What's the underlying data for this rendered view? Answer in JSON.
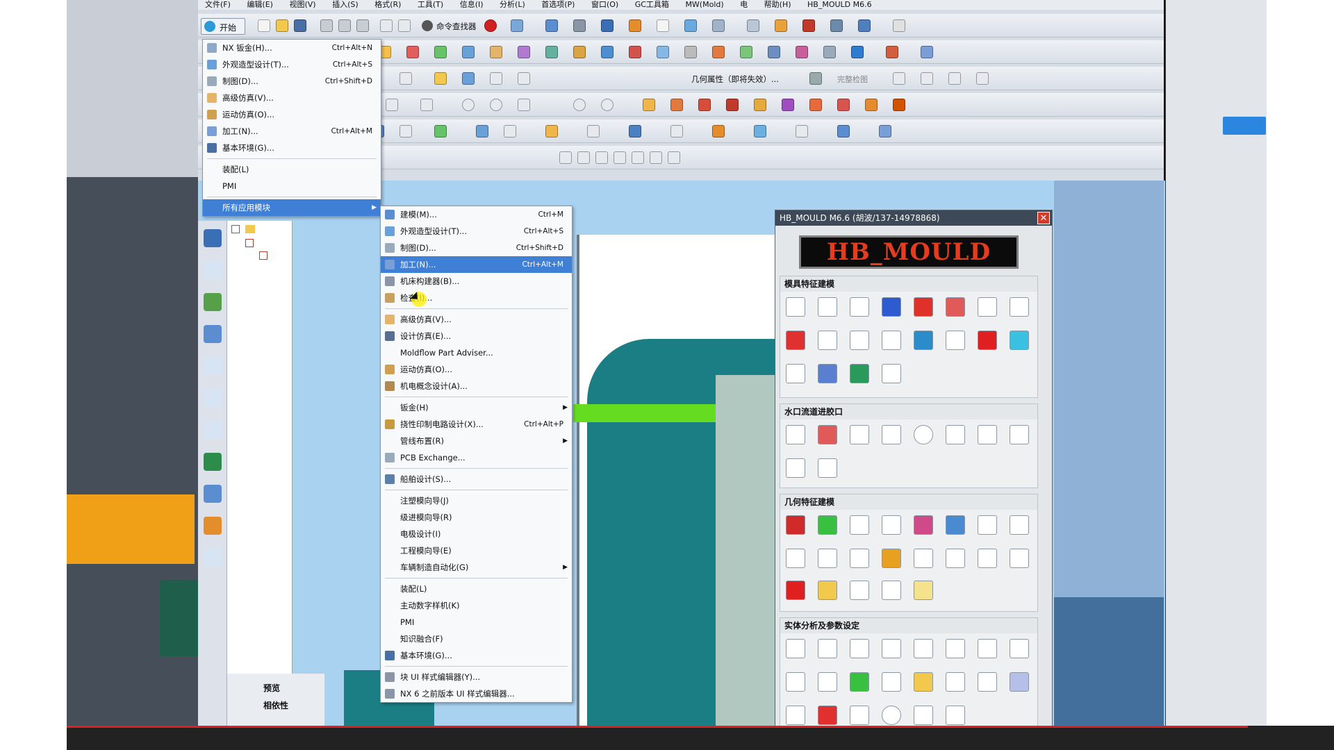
{
  "menubar": [
    "分析(L)",
    "首选项(P)",
    "窗口",
    "文件(F)",
    "编辑(E)",
    "视图(V)",
    "插入(S)",
    "格式(R)",
    "工具(T)",
    "信息(I)",
    "分析(L)",
    "首选项(P)",
    "窗口(O)",
    "GC工具箱",
    "MW(Mold)",
    "电",
    "帮助(H)",
    "HB_MOULD M6.6"
  ],
  "toolbar": {
    "start_label": "开始",
    "cmd_finder_label": "命令查找器",
    "geom_attr_label": "几何属性（即将失效）...",
    "full_check_label": "完整检图"
  },
  "start_menu": {
    "items": [
      {
        "label": "NX 钣金(H)...",
        "shortcut": "Ctrl+Alt+N"
      },
      {
        "label": "外观造型设计(T)...",
        "shortcut": "Ctrl+Alt+S"
      },
      {
        "label": "制图(D)...",
        "shortcut": "Ctrl+Shift+D"
      },
      {
        "label": "高级仿真(V)...",
        "shortcut": ""
      },
      {
        "label": "运动仿真(O)...",
        "shortcut": ""
      },
      {
        "label": "加工(N)...",
        "shortcut": "Ctrl+Alt+M"
      },
      {
        "label": "基本环境(G)...",
        "shortcut": ""
      },
      {
        "label": "装配(L)",
        "shortcut": ""
      },
      {
        "label": "PMI",
        "shortcut": ""
      },
      {
        "label": "所有应用模块",
        "shortcut": ""
      }
    ]
  },
  "all_apps_menu": {
    "items": [
      {
        "label": "建模(M)...",
        "shortcut": "Ctrl+M"
      },
      {
        "label": "外观造型设计(T)...",
        "shortcut": "Ctrl+Alt+S"
      },
      {
        "label": "制图(D)...",
        "shortcut": "Ctrl+Shift+D"
      },
      {
        "label": "加工(N)...",
        "shortcut": "Ctrl+Alt+M"
      },
      {
        "label": "机床构建器(B)...",
        "shortcut": ""
      },
      {
        "label": "检查(I)...",
        "shortcut": ""
      },
      {
        "label": "高级仿真(V)...",
        "shortcut": ""
      },
      {
        "label": "设计仿真(E)...",
        "shortcut": ""
      },
      {
        "label": "Moldflow Part Adviser...",
        "shortcut": ""
      },
      {
        "label": "运动仿真(O)...",
        "shortcut": ""
      },
      {
        "label": "机电概念设计(A)...",
        "shortcut": ""
      },
      {
        "label": "钣金(H)",
        "shortcut": ""
      },
      {
        "label": "挠性印制电路设计(X)...",
        "shortcut": "Ctrl+Alt+P"
      },
      {
        "label": "管线布置(R)",
        "shortcut": ""
      },
      {
        "label": "PCB Exchange...",
        "shortcut": ""
      },
      {
        "label": "船舶设计(S)...",
        "shortcut": ""
      },
      {
        "label": "注塑模向导(J)",
        "shortcut": ""
      },
      {
        "label": "级进模向导(R)",
        "shortcut": ""
      },
      {
        "label": "电极设计(I)",
        "shortcut": ""
      },
      {
        "label": "工程模向导(E)",
        "shortcut": ""
      },
      {
        "label": "车辆制造自动化(G)",
        "shortcut": ""
      },
      {
        "label": "装配(L)",
        "shortcut": ""
      },
      {
        "label": "主动数字样机(K)",
        "shortcut": ""
      },
      {
        "label": "PMI",
        "shortcut": ""
      },
      {
        "label": "知识融合(F)",
        "shortcut": ""
      },
      {
        "label": "基本环境(G)...",
        "shortcut": ""
      },
      {
        "label": "块 UI 样式编辑器(Y)...",
        "shortcut": ""
      },
      {
        "label": "NX 6 之前版本 UI 样式编辑器...",
        "shortcut": ""
      }
    ]
  },
  "navigator": {
    "preview_label": "预览",
    "dependency_label": "相依性"
  },
  "hb_mould": {
    "title": "HB_MOULD M6.6 (胡波/137-14978868)",
    "logo_text": "HB_MOULD",
    "sections": [
      {
        "title": "模具特征建模"
      },
      {
        "title": "水口流道进胶口"
      },
      {
        "title": "几何特征建模"
      },
      {
        "title": "实体分析及参数设定"
      }
    ]
  }
}
